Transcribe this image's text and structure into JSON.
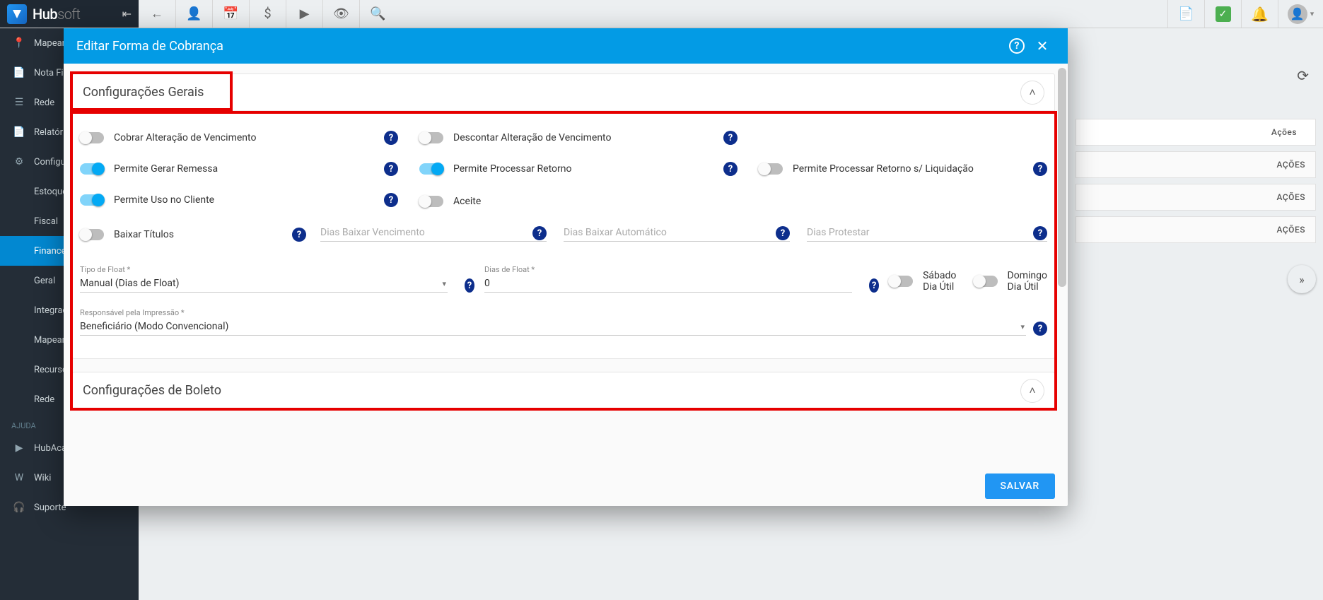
{
  "brand": {
    "hub": "Hub",
    "soft": "soft"
  },
  "topbar": {
    "icons": [
      "←",
      "👤",
      "📅",
      "$",
      "▶",
      "👁",
      "🔍"
    ]
  },
  "sidebar": {
    "items": [
      {
        "icon": "📍",
        "label": "Mapeament"
      },
      {
        "icon": "📄",
        "label": "Nota Fisca"
      },
      {
        "icon": "☰",
        "label": "Rede"
      },
      {
        "icon": "📄",
        "label": "Relatórios"
      },
      {
        "icon": "⚙",
        "label": "Configura"
      },
      {
        "icon": "",
        "label": "Estoque"
      },
      {
        "icon": "",
        "label": "Fiscal"
      },
      {
        "icon": "",
        "label": "Financeiro",
        "active": true
      },
      {
        "icon": "",
        "label": "Geral"
      },
      {
        "icon": "",
        "label": "Integraçõe"
      },
      {
        "icon": "",
        "label": "Mapeame"
      },
      {
        "icon": "",
        "label": "Recursos"
      },
      {
        "icon": "",
        "label": "Rede"
      }
    ],
    "help_header": "AJUDA",
    "help": [
      {
        "icon": "▶",
        "label": "HubAcade"
      },
      {
        "icon": "W",
        "label": "Wiki"
      },
      {
        "icon": "🎧",
        "label": "Suporte"
      }
    ]
  },
  "behind": {
    "acoes": "AÇÕES",
    "acoes_small": "Ações"
  },
  "modal": {
    "title": "Editar Forma de Cobrança",
    "save": "SALVAR",
    "section1": {
      "title": "Configurações Gerais",
      "toggles": {
        "cobrar_alteracao": "Cobrar Alteração de Vencimento",
        "descontar_alteracao": "Descontar Alteração de Vencimento",
        "permite_remessa": "Permite Gerar Remessa",
        "permite_retorno": "Permite Processar Retorno",
        "permite_retorno_sliq": "Permite Processar Retorno s/ Liquidação",
        "permite_uso_cliente": "Permite Uso no Cliente",
        "aceite": "Aceite",
        "baixar_titulos": "Baixar Títulos",
        "sabado": "Sábado Dia Útil",
        "domingo": "Domingo Dia Útil"
      },
      "fields": {
        "dias_baixar_venc_ph": "Dias Baixar Vencimento",
        "dias_baixar_auto_ph": "Dias Baixar Automático",
        "dias_protestar_ph": "Dias Protestar",
        "tipo_float_label": "Tipo de Float *",
        "tipo_float_value": "Manual (Dias de Float)",
        "dias_float_label": "Dias de Float *",
        "dias_float_value": "0",
        "resp_impressao_label": "Responsável pela Impressão *",
        "resp_impressao_value": "Beneficiário (Modo Convencional)"
      }
    },
    "section2": {
      "title": "Configurações de Boleto"
    }
  }
}
